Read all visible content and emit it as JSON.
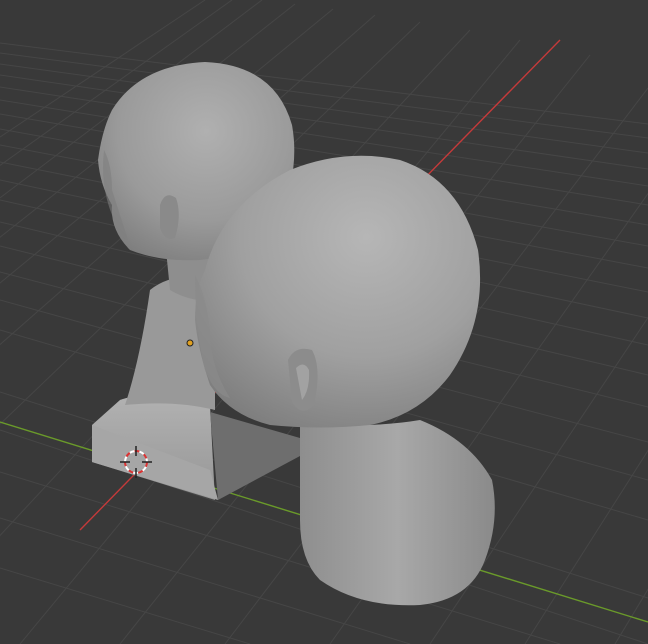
{
  "viewport": {
    "background": "#393939",
    "grid_color": "#4a4a4a",
    "x_axis_color": "#c43a3a",
    "y_axis_color": "#6a9a2a",
    "object_color": "#9c9c9c"
  },
  "icons": {
    "cursor": "3d-cursor-icon",
    "origin": "object-origin-icon"
  }
}
